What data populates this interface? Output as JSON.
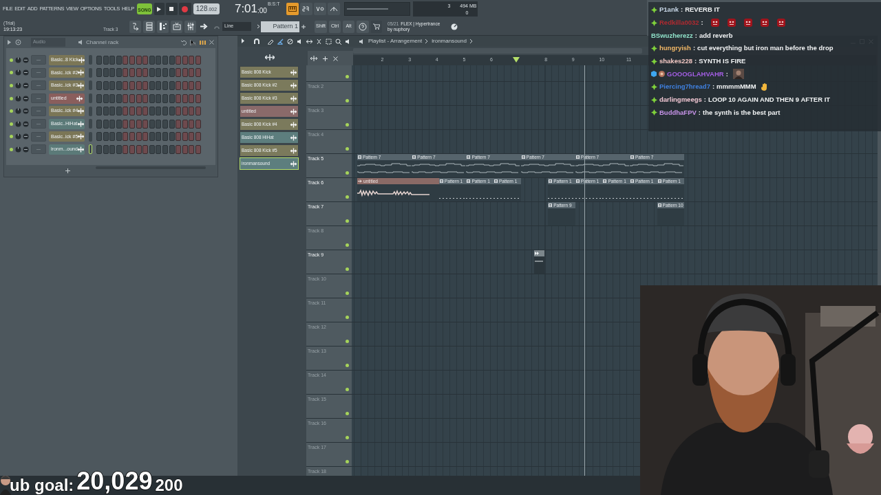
{
  "menu": [
    "FILE",
    "EDIT",
    "ADD",
    "PATTERNS",
    "VIEW",
    "OPTIONS",
    "TOOLS",
    "HELP"
  ],
  "transport": {
    "mode": "SONG",
    "tempo_main": "128",
    "tempo_fraction": ".002",
    "time_main": "7:01",
    "time_sub": ":00",
    "time_units": "B:S:T"
  },
  "status": {
    "license": "(Trial)",
    "clock": "19:13:23",
    "hint": "Track 3"
  },
  "snap": "Line",
  "pattern": "Pattern 1",
  "modifiers": [
    "Shift",
    "Ctrl",
    "Alt"
  ],
  "news": {
    "date": "05/21",
    "title": "FLEX | Hypertrance",
    "byline": "by nuphory"
  },
  "cpu": {
    "polyphony": "3",
    "memory": "494 MB",
    "voices": "0"
  },
  "channel_rack": {
    "title": "Channel rack",
    "group": "Audio",
    "channels": [
      {
        "mixer": "---",
        "name": "Basic..8 Kick",
        "color": "#7b7656",
        "selected": false
      },
      {
        "mixer": "---",
        "name": "Basic..ick #2",
        "color": "#7b7656",
        "selected": false
      },
      {
        "mixer": "---",
        "name": "Basic..ick #3",
        "color": "#7b7656",
        "selected": false
      },
      {
        "mixer": "---",
        "name": "untitled",
        "color": "#8a5e5c",
        "selected": false
      },
      {
        "mixer": "---",
        "name": "Basic..ick #4",
        "color": "#7b7656",
        "selected": false
      },
      {
        "mixer": "---",
        "name": "Basic..HiHat",
        "color": "#5b7a78",
        "selected": false
      },
      {
        "mixer": "---",
        "name": "Basic..ick #5",
        "color": "#7b7656",
        "selected": false
      },
      {
        "mixer": "---",
        "name": "ironm...ound",
        "color": "#5b7a78",
        "selected": true
      }
    ]
  },
  "playlist": {
    "title": "Playlist - Arrangement",
    "breadcrumb": "ironmansound",
    "picker": [
      {
        "label": "Basic 808 Kick",
        "color": "#7b7a5c",
        "selected": false
      },
      {
        "label": "Basic 808 Kick #2",
        "color": "#7b7a5c",
        "selected": false
      },
      {
        "label": "Basic 808 Kick #3",
        "color": "#7b7a5c",
        "selected": false
      },
      {
        "label": "untitled",
        "color": "#8a6a6a",
        "selected": false
      },
      {
        "label": "Basic 808 Kick #4",
        "color": "#7b7a5c",
        "selected": false
      },
      {
        "label": "Basic 808 HiHat",
        "color": "#5d7e7e",
        "selected": false
      },
      {
        "label": "Basic 808 Kick #5",
        "color": "#7b7a5c",
        "selected": false
      },
      {
        "label": "ironmansound",
        "color": "#5d7e7e",
        "selected": true
      }
    ],
    "ruler": [
      "2",
      "3",
      "4",
      "5",
      "6",
      "8",
      "9",
      "10",
      "11"
    ],
    "tracks": [
      {
        "label": "Track 2",
        "active": false
      },
      {
        "label": "Track 3",
        "active": false
      },
      {
        "label": "Track 4",
        "active": false
      },
      {
        "label": "Track 5",
        "active": true,
        "clips": [
          {
            "kind": "notes",
            "label": "Pattern 7"
          },
          {
            "kind": "notes",
            "label": "Pattern 7"
          },
          {
            "kind": "notes",
            "label": "Pattern 7"
          },
          {
            "kind": "notes",
            "label": "Pattern 7"
          },
          {
            "kind": "notes",
            "label": "Pattern 7"
          },
          {
            "kind": "notes",
            "label": "Pattern 7"
          }
        ]
      },
      {
        "label": "Track 6",
        "active": true,
        "clips": [
          {
            "kind": "audio",
            "label": "untitled"
          },
          {
            "kind": "dots",
            "label": "Pattern 1"
          },
          {
            "kind": "dots",
            "label": "Pattern 1"
          },
          {
            "kind": "dots",
            "label": "Pattern 1"
          },
          {
            "kind": "gap"
          },
          {
            "kind": "dots",
            "label": "Pattern 1"
          },
          {
            "kind": "dots",
            "label": "Pattern 1"
          },
          {
            "kind": "dots",
            "label": "Pattern 1"
          },
          {
            "kind": "dots",
            "label": "Pattern 1"
          },
          {
            "kind": "dots",
            "label": "Pattern 1"
          }
        ]
      },
      {
        "label": "Track 7",
        "active": true,
        "clips": [
          {
            "kind": "gap"
          },
          {
            "kind": "gap"
          },
          {
            "kind": "gap"
          },
          {
            "kind": "gap"
          },
          {
            "kind": "gap"
          },
          {
            "kind": "gap"
          },
          {
            "kind": "gap"
          },
          {
            "kind": "empty",
            "label": "Pattern 9"
          },
          {
            "kind": "gap"
          },
          {
            "kind": "gap"
          },
          {
            "kind": "gap"
          },
          {
            "kind": "empty",
            "label": "Pattern 10"
          }
        ]
      },
      {
        "label": "Track 8",
        "active": false
      },
      {
        "label": "Track 9",
        "active": true,
        "clips": [
          {
            "kind": "gap"
          },
          {
            "kind": "gap"
          },
          {
            "kind": "gap"
          },
          {
            "kind": "gap"
          },
          {
            "kind": "gap"
          },
          {
            "kind": "gap"
          },
          {
            "kind": "marker"
          }
        ]
      },
      {
        "label": "Track 10",
        "active": false
      },
      {
        "label": "Track 11",
        "active": false
      },
      {
        "label": "Track 12",
        "active": false
      },
      {
        "label": "Track 13",
        "active": false
      },
      {
        "label": "Track 14",
        "active": false
      },
      {
        "label": "Track 15",
        "active": false
      },
      {
        "label": "Track 16",
        "active": false
      },
      {
        "label": "Track 17",
        "active": false
      },
      {
        "label": "Track 18",
        "active": false
      }
    ]
  },
  "chat": [
    {
      "user": "P1ank",
      "color": "#c9d8e8",
      "kind": "sub",
      "separator": ":",
      "message": "REVERB IT"
    },
    {
      "user": "Redkilla0032",
      "color": "#b02a30",
      "kind": "sub",
      "separator": ":",
      "emotes": [
        {
          "kind": "red"
        },
        {
          "kind": "red"
        },
        {
          "kind": "red"
        },
        {
          "kind": "red"
        },
        {
          "kind": "red"
        }
      ]
    },
    {
      "user": "BSwuzherezz",
      "color": "#8fe0c8",
      "kind": "plain",
      "separator": ":",
      "message": "add reverb"
    },
    {
      "user": "hungryish",
      "color": "#f2b866",
      "kind": "sub",
      "separator": ":",
      "message": "cut everything but iron man before the drop"
    },
    {
      "user": "shakes228",
      "color": "#f2c8c4",
      "kind": "sub",
      "separator": ":",
      "message": "SYNTH IS FIRE"
    },
    {
      "user": "GOOOGLAHVAHR",
      "color": "#a55ee6",
      "kind": "special",
      "separator": ":"
    },
    {
      "user": "Piercing7hread7",
      "color": "#3f80e0",
      "kind": "sub",
      "separator": ":",
      "message": "mmmmMMM",
      "emotes": [
        {
          "kind": "hand"
        }
      ]
    },
    {
      "user": "darlingmeegs",
      "color": "#f2c8d4",
      "kind": "sub",
      "separator": ":",
      "message": "LOOP 10 AGAIN AND THEN 9 AFTER IT"
    },
    {
      "user": "BuddhaFPV",
      "color": "#c894ea",
      "kind": "sub",
      "separator": ":",
      "message": "the synth is the best part"
    }
  ],
  "sub_goal": {
    "label": "ub goal:",
    "count": "20,029",
    "target": "200"
  }
}
